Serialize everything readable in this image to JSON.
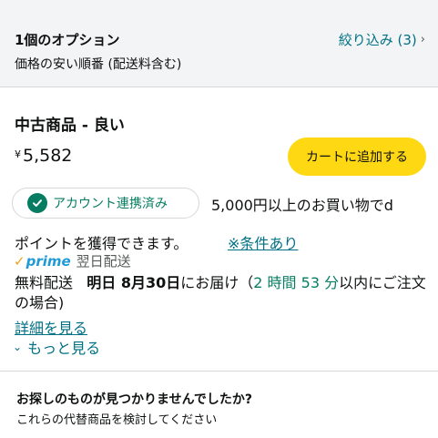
{
  "header": {
    "count": "1個のオプション",
    "sort": "価格の安い順番 (配送料含む)",
    "filter_label": "絞り込み (3)",
    "filter_chevron": "›"
  },
  "offer": {
    "condition": "中古商品 - 良い",
    "price_symbol": "¥",
    "price_amount": "5,582",
    "cart_label": "カートに追加する",
    "linked_label": "アカウント連携済み",
    "promo_text": "5,000円以上のお買い物でd",
    "points_text": "ポイントを獲得できます。",
    "conditions_link": "※条件あり",
    "prime_logo": "prime",
    "prime_delivery": "翌日配送",
    "delivery": {
      "free": "無料配送",
      "date": "明日 8月30日",
      "arrive": "にお届け（",
      "countdown": "2 時間 53 分",
      "suffix": "以内にご注文の場合)"
    },
    "details_link": "詳細を見る",
    "see_more": "もっと見る",
    "see_more_chevron": "⌄"
  },
  "footer": {
    "not_found": "お探しのものが見つかりませんでしたか?",
    "alternatives": "これらの代替商品を検討してください"
  },
  "colors": {
    "link": "#007185",
    "cart_button": "#ffd814",
    "linked_green": "#067d62",
    "prime_blue": "#1f9ad6",
    "header_bg": "#f2f4f5"
  },
  "icons": [
    "check-circle-icon",
    "chevron-right-icon",
    "chevron-down-icon",
    "prime-check-icon"
  ]
}
